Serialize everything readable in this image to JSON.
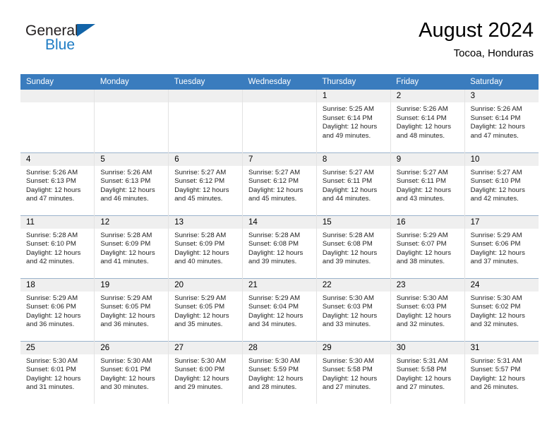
{
  "brand": {
    "name_part1": "General",
    "name_part2": "Blue",
    "triangle_color": "#1264a8",
    "blue_color": "#1f7cc4"
  },
  "header": {
    "title": "August 2024",
    "subtitle": "Tocoa, Honduras"
  },
  "theme": {
    "header_bg": "#3a7cbe",
    "header_text": "#ffffff",
    "daynum_bg": "#efefef",
    "row_border": "#9bb3cc"
  },
  "weekday_headers": [
    "Sunday",
    "Monday",
    "Tuesday",
    "Wednesday",
    "Thursday",
    "Friday",
    "Saturday"
  ],
  "weeks": [
    [
      {
        "day": "",
        "lines": []
      },
      {
        "day": "",
        "lines": []
      },
      {
        "day": "",
        "lines": []
      },
      {
        "day": "",
        "lines": []
      },
      {
        "day": "1",
        "lines": [
          "Sunrise: 5:25 AM",
          "Sunset: 6:14 PM",
          "Daylight: 12 hours",
          "and 49 minutes."
        ]
      },
      {
        "day": "2",
        "lines": [
          "Sunrise: 5:26 AM",
          "Sunset: 6:14 PM",
          "Daylight: 12 hours",
          "and 48 minutes."
        ]
      },
      {
        "day": "3",
        "lines": [
          "Sunrise: 5:26 AM",
          "Sunset: 6:14 PM",
          "Daylight: 12 hours",
          "and 47 minutes."
        ]
      }
    ],
    [
      {
        "day": "4",
        "lines": [
          "Sunrise: 5:26 AM",
          "Sunset: 6:13 PM",
          "Daylight: 12 hours",
          "and 47 minutes."
        ]
      },
      {
        "day": "5",
        "lines": [
          "Sunrise: 5:26 AM",
          "Sunset: 6:13 PM",
          "Daylight: 12 hours",
          "and 46 minutes."
        ]
      },
      {
        "day": "6",
        "lines": [
          "Sunrise: 5:27 AM",
          "Sunset: 6:12 PM",
          "Daylight: 12 hours",
          "and 45 minutes."
        ]
      },
      {
        "day": "7",
        "lines": [
          "Sunrise: 5:27 AM",
          "Sunset: 6:12 PM",
          "Daylight: 12 hours",
          "and 45 minutes."
        ]
      },
      {
        "day": "8",
        "lines": [
          "Sunrise: 5:27 AM",
          "Sunset: 6:11 PM",
          "Daylight: 12 hours",
          "and 44 minutes."
        ]
      },
      {
        "day": "9",
        "lines": [
          "Sunrise: 5:27 AM",
          "Sunset: 6:11 PM",
          "Daylight: 12 hours",
          "and 43 minutes."
        ]
      },
      {
        "day": "10",
        "lines": [
          "Sunrise: 5:27 AM",
          "Sunset: 6:10 PM",
          "Daylight: 12 hours",
          "and 42 minutes."
        ]
      }
    ],
    [
      {
        "day": "11",
        "lines": [
          "Sunrise: 5:28 AM",
          "Sunset: 6:10 PM",
          "Daylight: 12 hours",
          "and 42 minutes."
        ]
      },
      {
        "day": "12",
        "lines": [
          "Sunrise: 5:28 AM",
          "Sunset: 6:09 PM",
          "Daylight: 12 hours",
          "and 41 minutes."
        ]
      },
      {
        "day": "13",
        "lines": [
          "Sunrise: 5:28 AM",
          "Sunset: 6:09 PM",
          "Daylight: 12 hours",
          "and 40 minutes."
        ]
      },
      {
        "day": "14",
        "lines": [
          "Sunrise: 5:28 AM",
          "Sunset: 6:08 PM",
          "Daylight: 12 hours",
          "and 39 minutes."
        ]
      },
      {
        "day": "15",
        "lines": [
          "Sunrise: 5:28 AM",
          "Sunset: 6:08 PM",
          "Daylight: 12 hours",
          "and 39 minutes."
        ]
      },
      {
        "day": "16",
        "lines": [
          "Sunrise: 5:29 AM",
          "Sunset: 6:07 PM",
          "Daylight: 12 hours",
          "and 38 minutes."
        ]
      },
      {
        "day": "17",
        "lines": [
          "Sunrise: 5:29 AM",
          "Sunset: 6:06 PM",
          "Daylight: 12 hours",
          "and 37 minutes."
        ]
      }
    ],
    [
      {
        "day": "18",
        "lines": [
          "Sunrise: 5:29 AM",
          "Sunset: 6:06 PM",
          "Daylight: 12 hours",
          "and 36 minutes."
        ]
      },
      {
        "day": "19",
        "lines": [
          "Sunrise: 5:29 AM",
          "Sunset: 6:05 PM",
          "Daylight: 12 hours",
          "and 36 minutes."
        ]
      },
      {
        "day": "20",
        "lines": [
          "Sunrise: 5:29 AM",
          "Sunset: 6:05 PM",
          "Daylight: 12 hours",
          "and 35 minutes."
        ]
      },
      {
        "day": "21",
        "lines": [
          "Sunrise: 5:29 AM",
          "Sunset: 6:04 PM",
          "Daylight: 12 hours",
          "and 34 minutes."
        ]
      },
      {
        "day": "22",
        "lines": [
          "Sunrise: 5:30 AM",
          "Sunset: 6:03 PM",
          "Daylight: 12 hours",
          "and 33 minutes."
        ]
      },
      {
        "day": "23",
        "lines": [
          "Sunrise: 5:30 AM",
          "Sunset: 6:03 PM",
          "Daylight: 12 hours",
          "and 32 minutes."
        ]
      },
      {
        "day": "24",
        "lines": [
          "Sunrise: 5:30 AM",
          "Sunset: 6:02 PM",
          "Daylight: 12 hours",
          "and 32 minutes."
        ]
      }
    ],
    [
      {
        "day": "25",
        "lines": [
          "Sunrise: 5:30 AM",
          "Sunset: 6:01 PM",
          "Daylight: 12 hours",
          "and 31 minutes."
        ]
      },
      {
        "day": "26",
        "lines": [
          "Sunrise: 5:30 AM",
          "Sunset: 6:01 PM",
          "Daylight: 12 hours",
          "and 30 minutes."
        ]
      },
      {
        "day": "27",
        "lines": [
          "Sunrise: 5:30 AM",
          "Sunset: 6:00 PM",
          "Daylight: 12 hours",
          "and 29 minutes."
        ]
      },
      {
        "day": "28",
        "lines": [
          "Sunrise: 5:30 AM",
          "Sunset: 5:59 PM",
          "Daylight: 12 hours",
          "and 28 minutes."
        ]
      },
      {
        "day": "29",
        "lines": [
          "Sunrise: 5:30 AM",
          "Sunset: 5:58 PM",
          "Daylight: 12 hours",
          "and 27 minutes."
        ]
      },
      {
        "day": "30",
        "lines": [
          "Sunrise: 5:31 AM",
          "Sunset: 5:58 PM",
          "Daylight: 12 hours",
          "and 27 minutes."
        ]
      },
      {
        "day": "31",
        "lines": [
          "Sunrise: 5:31 AM",
          "Sunset: 5:57 PM",
          "Daylight: 12 hours",
          "and 26 minutes."
        ]
      }
    ]
  ]
}
